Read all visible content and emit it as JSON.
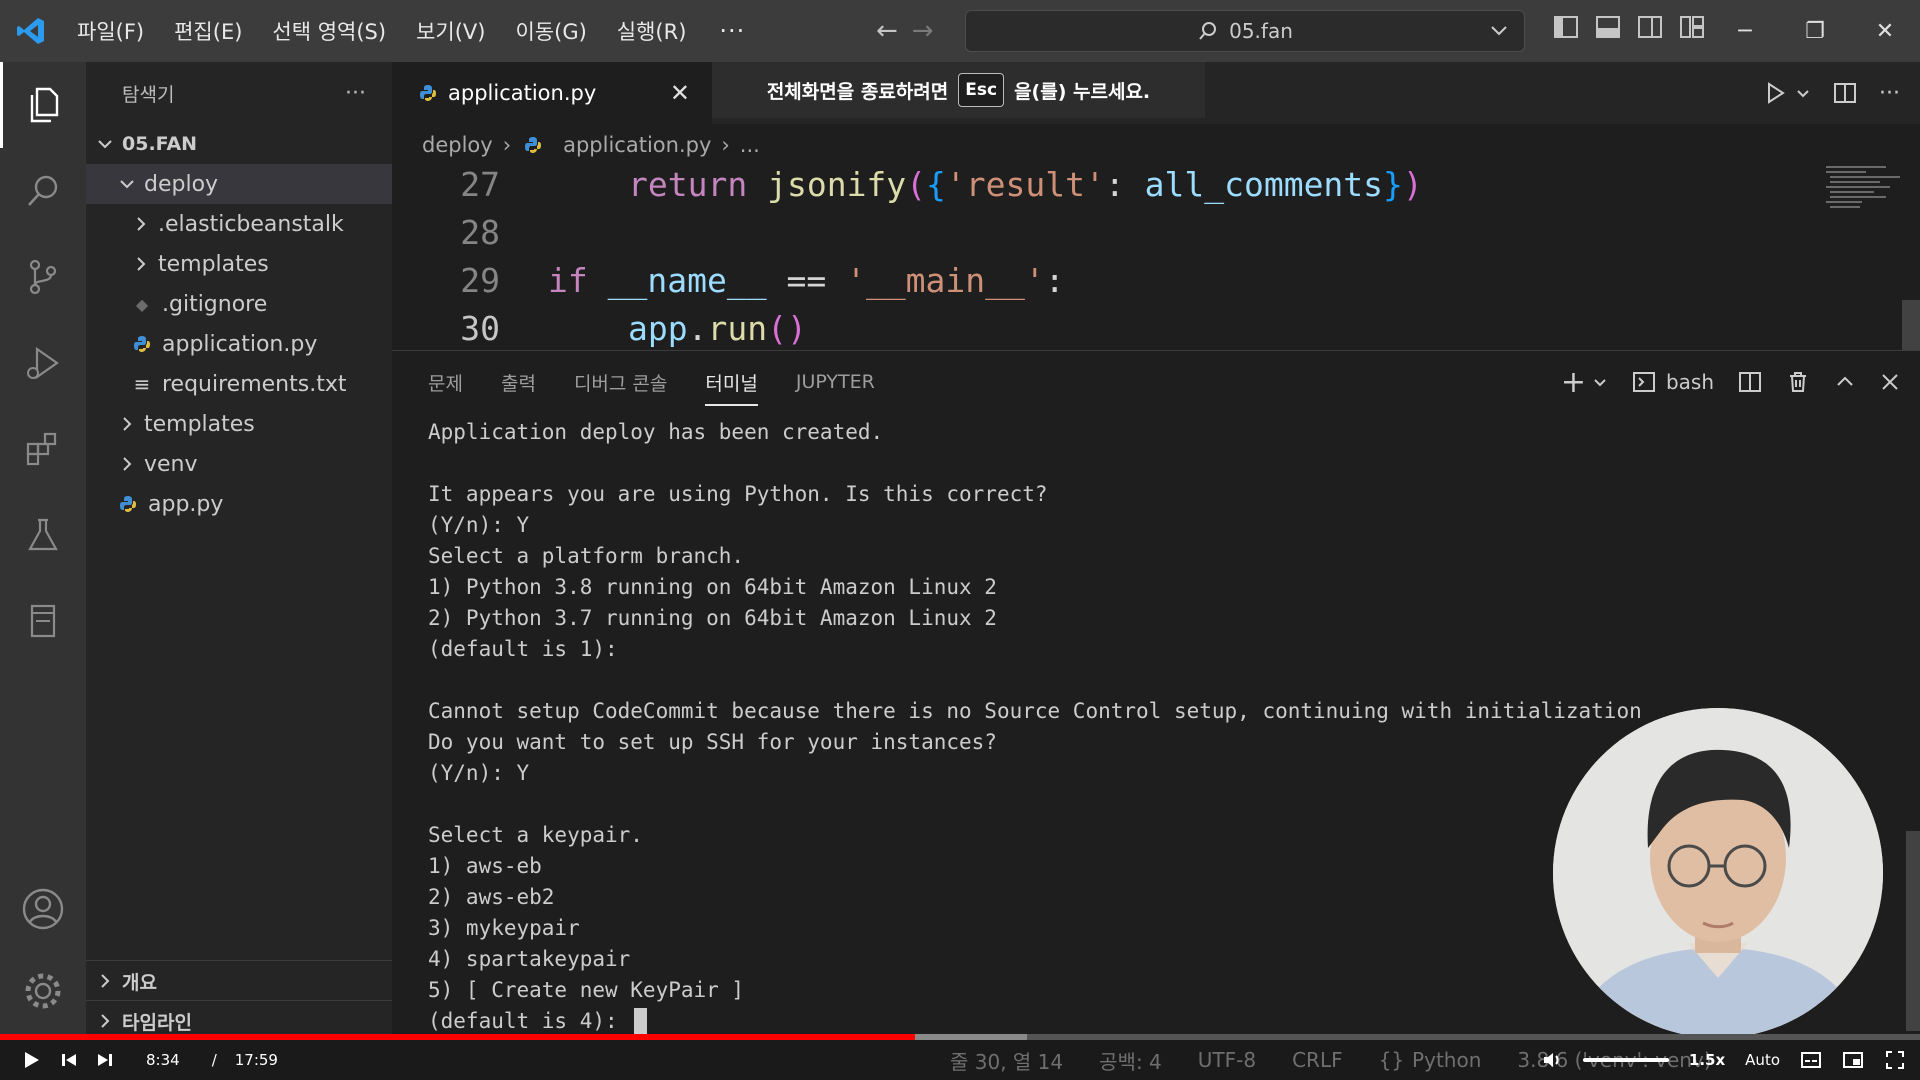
{
  "titlebar": {
    "menu": [
      "파일(F)",
      "편집(E)",
      "선택 영역(S)",
      "보기(V)",
      "이동(G)",
      "실행(R)"
    ],
    "more": "···",
    "search_text": "05.fan"
  },
  "sidebar": {
    "title": "탐색기",
    "more": "···",
    "root": "05.FAN",
    "items": [
      {
        "label": "deploy"
      },
      {
        "label": ".elasticbeanstalk"
      },
      {
        "label": "templates"
      },
      {
        "label": ".gitignore"
      },
      {
        "label": "application.py"
      },
      {
        "label": "requirements.txt"
      },
      {
        "label": "templates"
      },
      {
        "label": "venv"
      },
      {
        "label": "app.py"
      }
    ],
    "outline": "개요",
    "timeline": "타임라인"
  },
  "editor": {
    "tab_label": "application.py",
    "fullscreen_notice_before": "전체화면을 종료하려면",
    "fullscreen_key": "Esc",
    "fullscreen_notice_after": "을(를) 누르세요.",
    "breadcrumb": [
      "deploy",
      "application.py",
      "..."
    ],
    "lines": [
      "27",
      "28",
      "29",
      "30"
    ]
  },
  "panel": {
    "tabs": [
      "문제",
      "출력",
      "디버그 콘솔",
      "터미널",
      "JUPYTER"
    ],
    "active_tab": "터미널",
    "shell": "bash",
    "terminal_lines": [
      "Application deploy has been created.",
      "",
      "It appears you are using Python. Is this correct?",
      "(Y/n): Y",
      "Select a platform branch.",
      "1) Python 3.8 running on 64bit Amazon Linux 2",
      "2) Python 3.7 running on 64bit Amazon Linux 2",
      "(default is 1):",
      "",
      "Cannot setup CodeCommit because there is no Source Control setup, continuing with initialization",
      "Do you want to set up SSH for your instances?",
      "(Y/n): Y",
      "",
      "Select a keypair.",
      "1) aws-eb",
      "2) aws-eb2",
      "3) mykeypair",
      "4) spartakeypair",
      "5) [ Create new KeyPair ]",
      "(default is 4): "
    ]
  },
  "player": {
    "current_time": "8:34",
    "separator": "/",
    "duration": "17:59",
    "progress": 0.4764,
    "buffered": 0.535,
    "speed": "1.5x",
    "quality": "Auto"
  },
  "statusbar": {
    "position": "줄 30, 열 14",
    "spaces": "공백: 4",
    "encoding": "UTF-8",
    "eol": "CRLF",
    "language": "Python",
    "interpreter": "3.8.6 ('venv': venv)"
  },
  "colors": {
    "accent": "#007acc",
    "progress": "#ff0000",
    "python_icon": "#3e8fd6"
  }
}
